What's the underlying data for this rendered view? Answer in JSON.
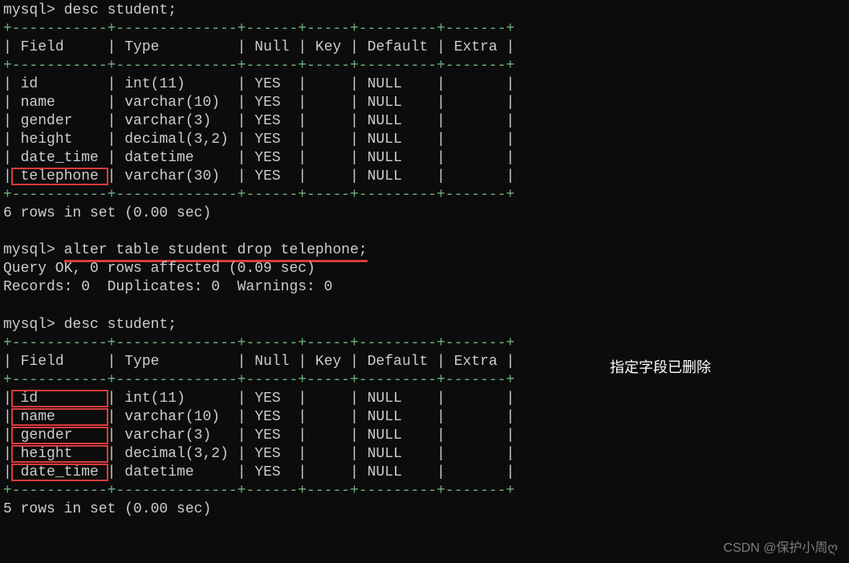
{
  "prompt": "mysql>",
  "commands": {
    "desc1": "desc student;",
    "alter": "alter table student drop telephone;",
    "desc2": "desc student;"
  },
  "headers": {
    "field": "Field",
    "type": "Type",
    "null": "Null",
    "key": "Key",
    "default": "Default",
    "extra": "Extra"
  },
  "table1": {
    "rows": [
      {
        "field": "id",
        "type": "int(11)",
        "null": "YES",
        "key": "",
        "default": "NULL",
        "extra": ""
      },
      {
        "field": "name",
        "type": "varchar(10)",
        "null": "YES",
        "key": "",
        "default": "NULL",
        "extra": ""
      },
      {
        "field": "gender",
        "type": "varchar(3)",
        "null": "YES",
        "key": "",
        "default": "NULL",
        "extra": ""
      },
      {
        "field": "height",
        "type": "decimal(3,2)",
        "null": "YES",
        "key": "",
        "default": "NULL",
        "extra": ""
      },
      {
        "field": "date_time",
        "type": "datetime",
        "null": "YES",
        "key": "",
        "default": "NULL",
        "extra": ""
      },
      {
        "field": "telephone",
        "type": "varchar(30)",
        "null": "YES",
        "key": "",
        "default": "NULL",
        "extra": ""
      }
    ],
    "summary": "6 rows in set (0.00 sec)"
  },
  "alter_result": {
    "line1": "Query OK, 0 rows affected (0.09 sec)",
    "line2": "Records: 0  Duplicates: 0  Warnings: 0"
  },
  "table2": {
    "rows": [
      {
        "field": "id",
        "type": "int(11)",
        "null": "YES",
        "key": "",
        "default": "NULL",
        "extra": ""
      },
      {
        "field": "name",
        "type": "varchar(10)",
        "null": "YES",
        "key": "",
        "default": "NULL",
        "extra": ""
      },
      {
        "field": "gender",
        "type": "varchar(3)",
        "null": "YES",
        "key": "",
        "default": "NULL",
        "extra": ""
      },
      {
        "field": "height",
        "type": "decimal(3,2)",
        "null": "YES",
        "key": "",
        "default": "NULL",
        "extra": ""
      },
      {
        "field": "date_time",
        "type": "datetime",
        "null": "YES",
        "key": "",
        "default": "NULL",
        "extra": ""
      }
    ],
    "summary": "5 rows in set (0.00 sec)"
  },
  "annotation": "指定字段已删除",
  "watermark": "CSDN @保护小周ღ",
  "border": {
    "top": "+-----------+--------------+------+-----+---------+-------+",
    "header": "| Field     | Type         | Null | Key | Default | Extra |",
    "sep": "+-----------+--------------+------+-----+---------+-------+"
  }
}
